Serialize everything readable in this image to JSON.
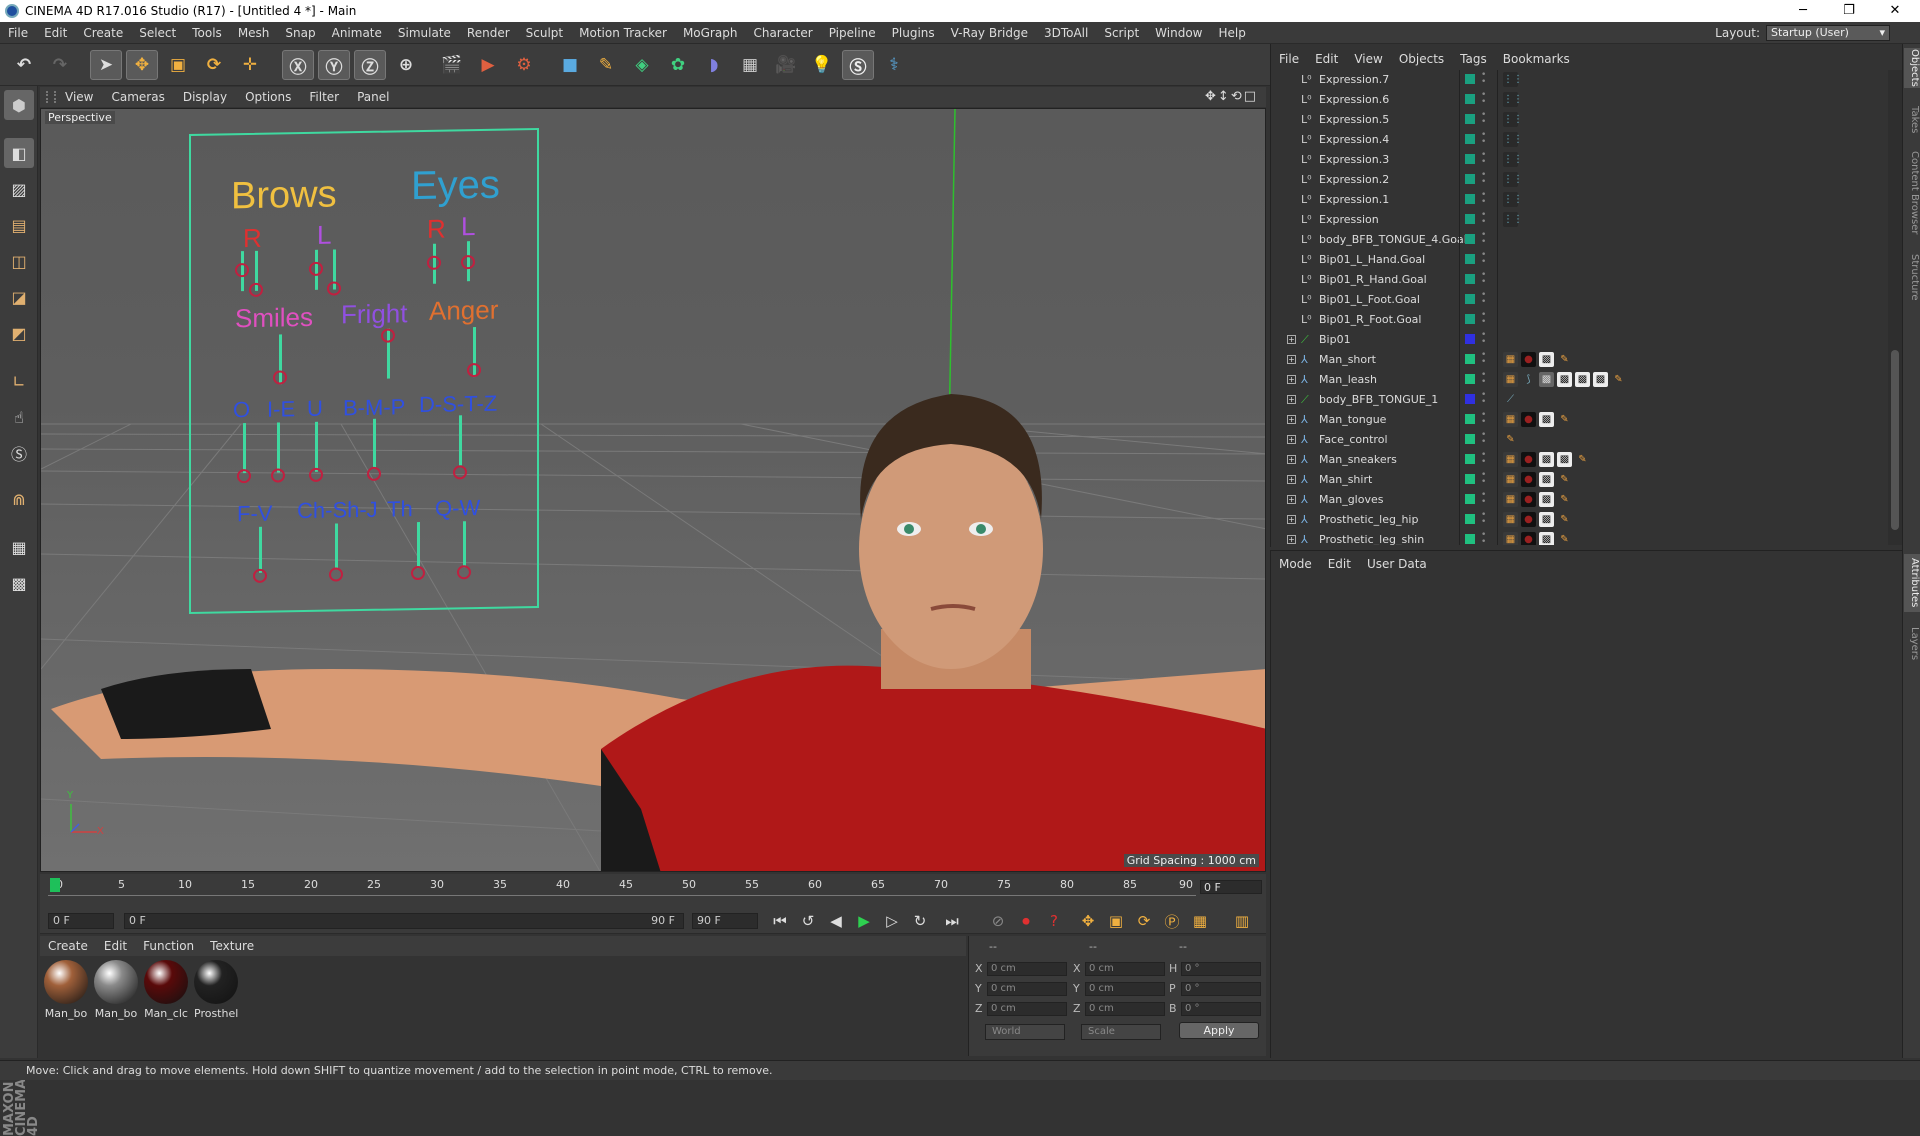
{
  "window": {
    "title": "CINEMA 4D R17.016 Studio (R17) - [Untitled 4 *] - Main",
    "min": "─",
    "max": "❐",
    "close": "✕"
  },
  "menu": [
    "File",
    "Edit",
    "Create",
    "Select",
    "Tools",
    "Mesh",
    "Snap",
    "Animate",
    "Simulate",
    "Render",
    "Sculpt",
    "Motion Tracker",
    "MoGraph",
    "Character",
    "Pipeline",
    "Plugins",
    "V-Ray Bridge",
    "3DToAll",
    "Script",
    "Window",
    "Help"
  ],
  "layout": {
    "label": "Layout:",
    "value": "Startup (User)"
  },
  "viewport": {
    "menu": [
      "View",
      "Cameras",
      "Display",
      "Options",
      "Filter",
      "Panel"
    ],
    "label": "Perspective",
    "grid": "Grid Spacing : 1000 cm",
    "nav": "✥↕⟲□"
  },
  "face": {
    "brows": "Brows",
    "eyes": "Eyes",
    "r1": "R",
    "l1": "L",
    "r2": "R",
    "l2": "L",
    "smiles": "Smiles",
    "fright": "Fright",
    "anger": "Anger",
    "o": "O",
    "ie": "I-E",
    "u": "U",
    "bmp": "B-M-P",
    "dstz": "D-S-T-Z",
    "fv": "F-V",
    "chshj": "Ch-Sh-J",
    "th": "Th",
    "qw": "Q-W"
  },
  "axes": {
    "y": "Y",
    "x": "X"
  },
  "timeline": {
    "ticks": [
      "0",
      "5",
      "10",
      "15",
      "20",
      "25",
      "30",
      "35",
      "40",
      "45",
      "50",
      "55",
      "60",
      "65",
      "70",
      "75",
      "80",
      "85",
      "90"
    ],
    "current": "0 F"
  },
  "transport": {
    "start": "0 F",
    "range_start": "0 F",
    "range_end": "90 F",
    "end": "90 F"
  },
  "material_menu": [
    "Create",
    "Edit",
    "Function",
    "Texture"
  ],
  "materials": [
    {
      "name": "Man_bo",
      "color": "#a0603a"
    },
    {
      "name": "Man_bo",
      "color": "#8a8a8a"
    },
    {
      "name": "Man_clc",
      "color": "#5a0a0a"
    },
    {
      "name": "Prosthel",
      "color": "#222"
    }
  ],
  "brand": "MAXON CINEMA 4D",
  "coords": {
    "hdr1": "--",
    "hdr2": "--",
    "hdr3": "--",
    "x": "X",
    "y": "Y",
    "z": "Z",
    "x2": "X",
    "y2": "Y",
    "z2": "Z",
    "h": "H",
    "p": "P",
    "b": "B",
    "xv": "0 cm",
    "yv": "0 cm",
    "zv": "0 cm",
    "x2v": "0 cm",
    "y2v": "0 cm",
    "z2v": "0 cm",
    "hv": "0 °",
    "pv": "0 °",
    "bv": "0 °",
    "world": "World",
    "scale": "Scale",
    "apply": "Apply"
  },
  "status": "Move: Click and drag to move elements. Hold down SHIFT to quantize movement / add to the selection in point mode, CTRL to remove.",
  "objmenu": [
    "File",
    "Edit",
    "View",
    "Objects",
    "Tags",
    "Bookmarks"
  ],
  "objects": [
    {
      "name": "Expression.7",
      "type": "L0",
      "color": "#1aa080",
      "tags": "dots"
    },
    {
      "name": "Expression.6",
      "type": "L0",
      "color": "#1aa080",
      "tags": "dots"
    },
    {
      "name": "Expression.5",
      "type": "L0",
      "color": "#1aa080",
      "tags": "dots"
    },
    {
      "name": "Expression.4",
      "type": "L0",
      "color": "#1aa080",
      "tags": "dots"
    },
    {
      "name": "Expression.3",
      "type": "L0",
      "color": "#1aa080",
      "tags": "dots"
    },
    {
      "name": "Expression.2",
      "type": "L0",
      "color": "#1aa080",
      "tags": "dots"
    },
    {
      "name": "Expression.1",
      "type": "L0",
      "color": "#1aa080",
      "tags": "dots"
    },
    {
      "name": "Expression",
      "type": "L0",
      "color": "#1aa080",
      "tags": "dots"
    },
    {
      "name": "body_BFB_TONGUE_4.Goal",
      "type": "L0",
      "color": "#1aa080",
      "tags": ""
    },
    {
      "name": "Bip01_L_Hand.Goal",
      "type": "L0",
      "color": "#1aa080",
      "tags": ""
    },
    {
      "name": "Bip01_R_Hand.Goal",
      "type": "L0",
      "color": "#1aa080",
      "tags": ""
    },
    {
      "name": "Bip01_L_Foot.Goal",
      "type": "L0",
      "color": "#1aa080",
      "tags": ""
    },
    {
      "name": "Bip01_R_Foot.Goal",
      "type": "L0",
      "color": "#1aa080",
      "tags": ""
    },
    {
      "name": "Bip01",
      "type": "bone",
      "color": "#3030e0",
      "tags": "",
      "expand": true
    },
    {
      "name": "Man_short",
      "type": "mesh",
      "color": "#20c080",
      "tags": "mat3",
      "expand": true
    },
    {
      "name": "Man_leash",
      "type": "mesh",
      "color": "#20c080",
      "tags": "mat6",
      "expand": true
    },
    {
      "name": "body_BFB_TONGUE_1",
      "type": "bone",
      "color": "#3030e0",
      "tags": "bone",
      "expand": true
    },
    {
      "name": "Man_tongue",
      "type": "mesh",
      "color": "#20c080",
      "tags": "mat3",
      "expand": true
    },
    {
      "name": "Face_control",
      "type": "mesh",
      "color": "#20c080",
      "tags": "one",
      "expand": true
    },
    {
      "name": "Man_sneakers",
      "type": "mesh",
      "color": "#20c080",
      "tags": "mat4",
      "expand": true
    },
    {
      "name": "Man_shirt",
      "type": "mesh",
      "color": "#20c080",
      "tags": "mat3",
      "expand": true
    },
    {
      "name": "Man_gloves",
      "type": "mesh",
      "color": "#20c080",
      "tags": "mat3",
      "expand": true
    },
    {
      "name": "Prosthetic_leg_hip",
      "type": "mesh",
      "color": "#20c080",
      "tags": "mat3",
      "expand": true
    },
    {
      "name": "Prosthetic_leg_shin",
      "type": "mesh",
      "color": "#20c080",
      "tags": "mat3",
      "expand": true
    }
  ],
  "attrmenu": [
    "Mode",
    "Edit",
    "User Data"
  ],
  "sidetabs": [
    "Objects",
    "Takes",
    "Content Browser",
    "Structure",
    "Attributes",
    "Layers"
  ],
  "icons": {
    "undo": "undo-icon",
    "redo": "redo-icon",
    "pointer": "pointer-icon",
    "move": "move-icon",
    "scale": "scale-icon",
    "rotate": "rotate-icon"
  }
}
